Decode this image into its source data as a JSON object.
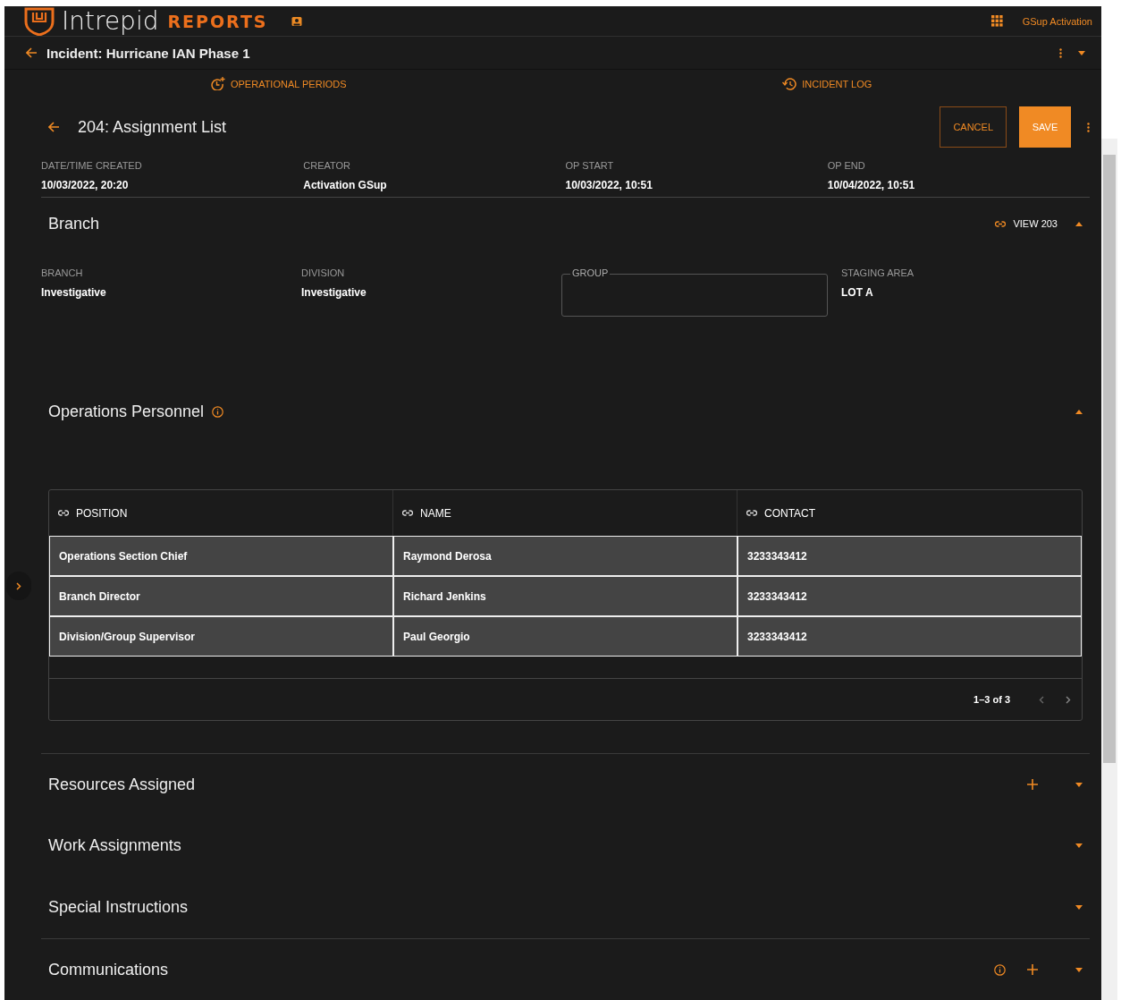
{
  "app": {
    "logo_word": "Intrepid",
    "logo_accent": "REPORTS",
    "user": "GSup Activation"
  },
  "incident": {
    "title": "Incident: Hurricane IAN Phase 1"
  },
  "tabs": [
    {
      "label": "OPERATIONAL PERIODS",
      "kind": "periods"
    },
    {
      "label": "INCIDENT LOG",
      "kind": "log"
    }
  ],
  "form": {
    "title": "204: Assignment List",
    "cancel": "CANCEL",
    "save": "SAVE"
  },
  "meta": [
    {
      "label": "DATE/TIME CREATED",
      "value": "10/03/2022, 20:20"
    },
    {
      "label": "CREATOR",
      "value": "Activation GSup"
    },
    {
      "label": "OP START",
      "value": "10/03/2022, 10:51"
    },
    {
      "label": "OP END",
      "value": "10/04/2022, 10:51"
    }
  ],
  "branch": {
    "title": "Branch",
    "link": "VIEW 203",
    "expanded": true,
    "fields": [
      {
        "kind": "text",
        "label": "BRANCH",
        "value": "Investigative"
      },
      {
        "kind": "text",
        "label": "DIVISION",
        "value": "Investigative"
      },
      {
        "kind": "input",
        "label": "GROUP"
      },
      {
        "kind": "text",
        "label": "STAGING AREA",
        "value": "LOT A"
      }
    ]
  },
  "personnel": {
    "title": "Operations Personnel",
    "expanded": true,
    "columns": [
      "POSITION",
      "NAME",
      "CONTACT"
    ],
    "rows": [
      [
        "Operations Section Chief",
        "Raymond Derosa",
        "3233343412"
      ],
      [
        "Branch Director",
        "Richard Jenkins",
        "3233343412"
      ],
      [
        "Division/Group Supervisor",
        "Paul Georgio",
        "3233343412"
      ]
    ],
    "pagination": "1–3 of 3"
  },
  "sections": [
    {
      "title": "Resources Assigned",
      "expanded": false,
      "divider": true,
      "add": true,
      "info": false
    },
    {
      "title": "Work Assignments",
      "expanded": false,
      "divider": false,
      "add": false,
      "info": false
    },
    {
      "title": "Special Instructions",
      "expanded": false,
      "divider": false,
      "add": false,
      "info": false
    },
    {
      "title": "Communications",
      "expanded": false,
      "divider": true,
      "add": true,
      "info": true
    }
  ]
}
